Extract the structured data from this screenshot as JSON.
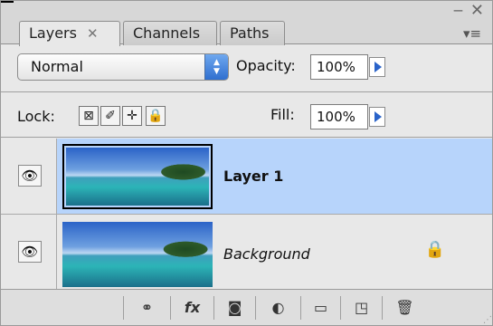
{
  "tabs": [
    {
      "label": "Layers",
      "close": "✕",
      "active": true
    },
    {
      "label": "Channels",
      "active": false
    },
    {
      "label": "Paths",
      "active": false
    }
  ],
  "window_controls": {
    "collapse": "‒",
    "close": "✕",
    "menu": "▾≡"
  },
  "blend": {
    "mode": "Normal",
    "opacity_label": "Opacity:",
    "opacity_value": "100%"
  },
  "lock": {
    "label": "Lock:",
    "fill_label": "Fill:",
    "fill_value": "100%"
  },
  "layers": [
    {
      "name": "Layer 1",
      "selected": true,
      "visible": true,
      "locked": false
    },
    {
      "name": "Background",
      "selected": false,
      "visible": true,
      "locked": true
    }
  ],
  "icons": {
    "eye": "👁",
    "lock": "🔒",
    "lock_transparent": "⊠",
    "lock_brush": "✐",
    "lock_move": "✛",
    "lock_all": "🔒",
    "link": "⚭",
    "fx": "fx",
    "mask": "◙",
    "adjustment": "◐",
    "folder": "▭",
    "new_layer": "◳",
    "trash": "🗑"
  },
  "colors": {
    "selected_row": "#b7d4fb",
    "accent_blue": "#2a63c9"
  }
}
